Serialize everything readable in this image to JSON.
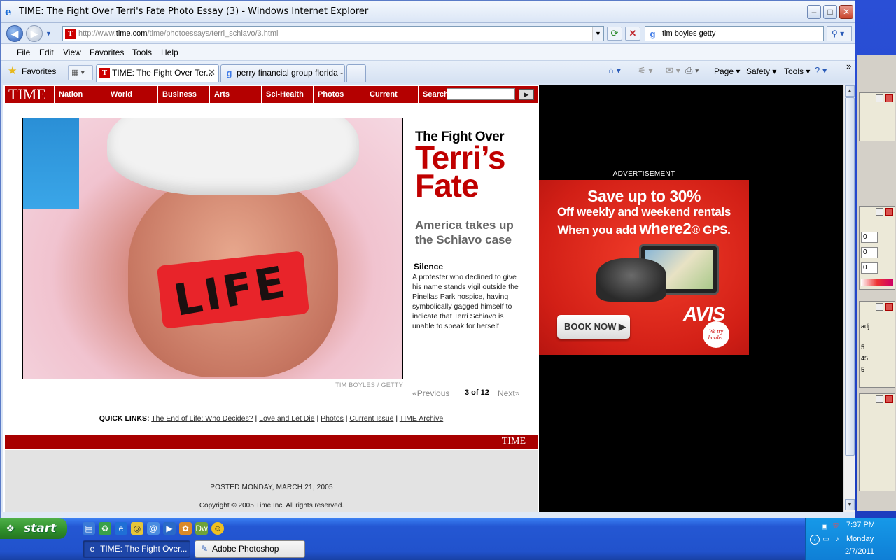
{
  "window": {
    "title": "TIME: The Fight Over Terri's Fate Photo Essay (3) - Windows Internet Explorer",
    "minimize": "–",
    "maximize": "□",
    "close": "✕"
  },
  "address": {
    "url_prefix": "http://www.",
    "url_domain": "time.com",
    "url_path": "/time/photoessays/terri_schiavo/3.html",
    "search_value": "tim boyles getty"
  },
  "menu": [
    "File",
    "Edit",
    "View",
    "Favorites",
    "Tools",
    "Help"
  ],
  "toolbar": {
    "favorites_label": "Favorites",
    "tabs": [
      {
        "label": "TIME: The Fight Over Ter..."
      },
      {
        "label": "perry financial group florida -..."
      }
    ],
    "commands": [
      "Page",
      "Safety",
      "Tools"
    ]
  },
  "time_nav": {
    "logo": "TIME",
    "items": [
      "Nation",
      "World",
      "Business",
      "Arts",
      "Sci-Health",
      "Photos",
      "Current Issue",
      "Search"
    ]
  },
  "photo": {
    "tape_text": "LIFE",
    "credit": "TIM BOYLES / GETTY"
  },
  "essay": {
    "title_top": "The Fight Over",
    "title_main": "Terri’s Fate",
    "subtitle": "America takes up the Schiavo case",
    "caption_head": "Silence",
    "caption_text": "A protester who declined to give his name stands vigil outside the Pinellas Park hospice, having symbolically gagged himself to indicate that Terri Schiavo is unable to speak for herself",
    "prev_label": "Previous",
    "count": "3 of 12",
    "next_label": "Next"
  },
  "quicklinks": {
    "label": "QUICK LINKS:",
    "links": [
      "The End of Life: Who Decides?",
      "Love and Let Die",
      "Photos",
      "Current Issue",
      "TIME Archive"
    ]
  },
  "footer": {
    "logo": "TIME",
    "posted": "POSTED MONDAY, MARCH 21, 2005",
    "copyright": "Copyright © 2005 Time Inc. All rights reserved."
  },
  "ad": {
    "label": "ADVERTISEMENT",
    "line1": "Save up to 30%",
    "line2": "Off weekly and weekend rentals",
    "line3_pre": "When you add ",
    "line3_brand": "where2",
    "line3_post": "® GPS.",
    "book_label": "BOOK NOW",
    "brand": "AVIS",
    "seal": "We try harder."
  },
  "taskbar": {
    "start_label": "start",
    "tasks": [
      {
        "label": "TIME: The Fight Over..."
      },
      {
        "label": "Adobe Photoshop"
      }
    ],
    "clock_time": "7:37 PM",
    "clock_day": "Monday",
    "clock_date": "2/7/2011"
  },
  "ps_panel_values": [
    "0",
    "0",
    "0",
    "adj...",
    "5",
    "45",
    "5"
  ]
}
